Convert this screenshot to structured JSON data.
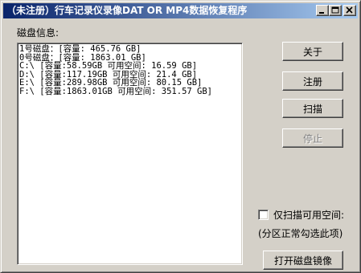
{
  "window": {
    "title": "（未注册）行车记录仪录像DAT OR MP4数据恢复程序"
  },
  "disk_info": {
    "label": "磁盘信息:",
    "items": [
      "1号磁盘：[容量: 465.76 GB]",
      "0号磁盘：[容量: 1863.01 GB]",
      "C:\\ [容量:58.59GB 可用空间: 16.59 GB]",
      "D:\\ [容量:117.19GB 可用空间: 21.4 GB]",
      "E:\\ [容量:289.98GB 可用空间: 80.15 GB]",
      "F:\\ [容量:1863.01GB 可用空间: 351.57 GB]"
    ]
  },
  "buttons": {
    "about": "关于",
    "register": "注册",
    "scan": "扫描",
    "stop": "停止",
    "open_image": "打开磁盘镜像"
  },
  "options": {
    "scan_free_space_label": "仅扫描可用空间:",
    "scan_free_space_checked": false,
    "hint": "(分区正常勾选此项)"
  },
  "icons": {
    "minimize": "minimize-icon",
    "maximize": "maximize-icon",
    "close": "close-icon"
  }
}
